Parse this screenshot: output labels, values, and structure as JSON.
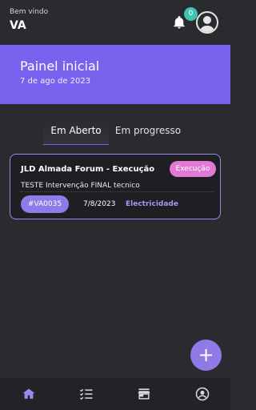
{
  "header": {
    "welcome": "Bem vindo",
    "user": "VA",
    "notifications_count": "0"
  },
  "banner": {
    "title": "Painel inicial",
    "date": "7 de ago de 2023"
  },
  "tabs": [
    {
      "label": "Em Aberto"
    },
    {
      "label": "Em progresso"
    }
  ],
  "card": {
    "title": "JLD Almada Forum - Execução",
    "status": "Execução",
    "description": "TESTE Intervenção FINAL tecnico",
    "code": "#VA0035",
    "date": "7/8/2023",
    "type": "Electricidade"
  },
  "fab": {
    "label": "+"
  },
  "colors": {
    "accent": "#7b62ee",
    "status_badge": "#e27ad4",
    "notification_badge": "#3fc4b0"
  },
  "bottom_nav": [
    {
      "icon": "home-icon"
    },
    {
      "icon": "checklist-icon"
    },
    {
      "icon": "store-icon"
    },
    {
      "icon": "profile-icon"
    }
  ]
}
